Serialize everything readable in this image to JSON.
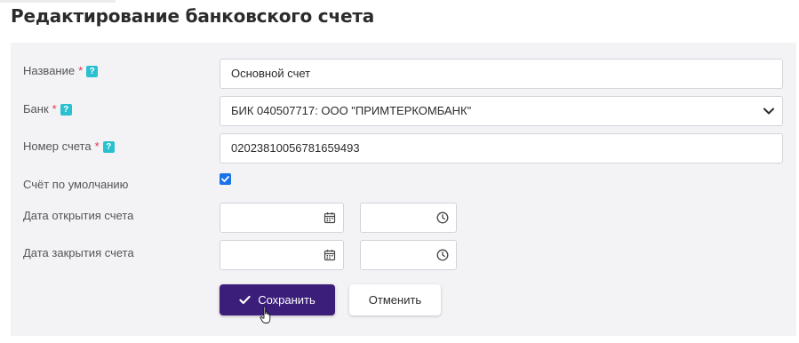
{
  "page": {
    "title": "Редактирование банковского счета"
  },
  "form": {
    "required_mark": "*",
    "help_mark": "?",
    "name": {
      "label": "Название",
      "value": "Основной счет"
    },
    "bank": {
      "label": "Банк",
      "value": "БИК 040507717:  ООО \"ПРИМТЕРКОМБАНК\""
    },
    "account_number": {
      "label": "Номер счета",
      "value": "02023810056781659493"
    },
    "default_account": {
      "label": "Счёт по умолчанию",
      "checked": true
    },
    "open_date": {
      "label": "Дата открытия счета",
      "date": "",
      "time": ""
    },
    "close_date": {
      "label": "Дата закрытия счета",
      "date": "",
      "time": ""
    }
  },
  "actions": {
    "save_label": "Сохранить",
    "cancel_label": "Отменить"
  },
  "icons": {
    "help": "question-icon",
    "select": "chevron-down-icon",
    "date": "calendar-icon",
    "time": "clock-icon",
    "save": "check-icon",
    "checkbox": "checkmark-icon",
    "cursor": "hand-cursor-icon"
  },
  "colors": {
    "primary_button": "#3b1d7a",
    "required": "#e0344e",
    "help": "#2bc0d0",
    "checkbox": "#1a73e8",
    "panel": "#f3f3f6"
  }
}
